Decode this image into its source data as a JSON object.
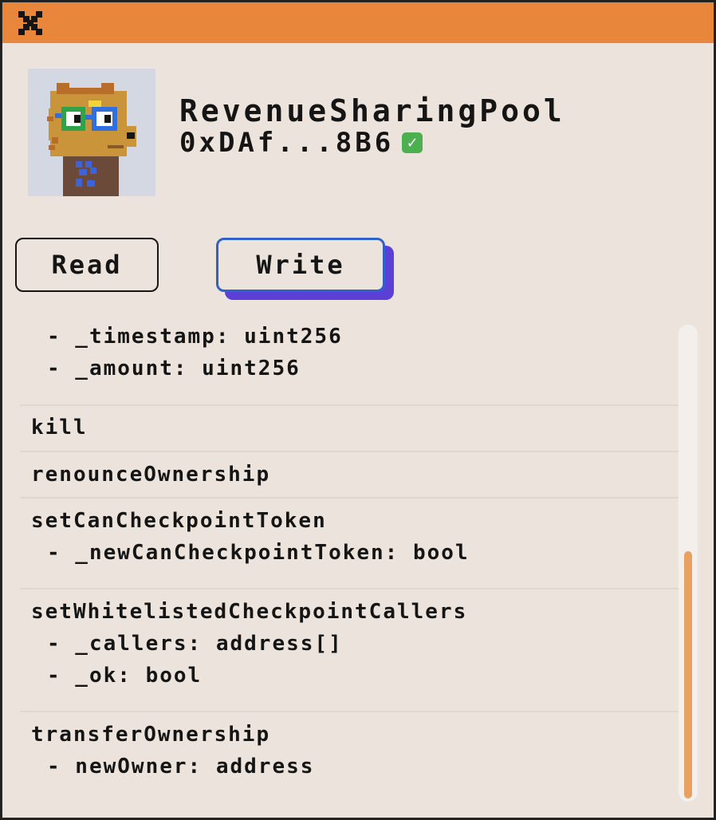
{
  "window": {
    "title_bar_color": "#e8873c",
    "close_icon": "close-icon"
  },
  "contract": {
    "name": "RevenueSharingPool",
    "address": "0xDAf...8B6",
    "verified_icon": "check-badge-icon",
    "avatar_icon": "pixel-dog-avatar-icon"
  },
  "tabs": [
    {
      "label": "Read",
      "active": false
    },
    {
      "label": "Write",
      "active": true
    }
  ],
  "functions": [
    {
      "name": "",
      "params": [
        "- _timestamp: uint256",
        "- _amount: uint256"
      ]
    },
    {
      "name": "kill",
      "params": []
    },
    {
      "name": "renounceOwnership",
      "params": []
    },
    {
      "name": "setCanCheckpointToken",
      "params": [
        "- _newCanCheckpointToken: bool"
      ]
    },
    {
      "name": "setWhitelistedCheckpointCallers",
      "params": [
        "- _callers: address[]",
        "- _ok: bool"
      ]
    },
    {
      "name": "transferOwnership",
      "params": [
        "- newOwner: address"
      ]
    }
  ],
  "colors": {
    "background": "#ece4dc",
    "accent_orange": "#e8873c",
    "write_tab_border": "#2d63c8",
    "write_tab_shadow": "#5b3fd6",
    "scroll_thumb": "#e9a161"
  }
}
